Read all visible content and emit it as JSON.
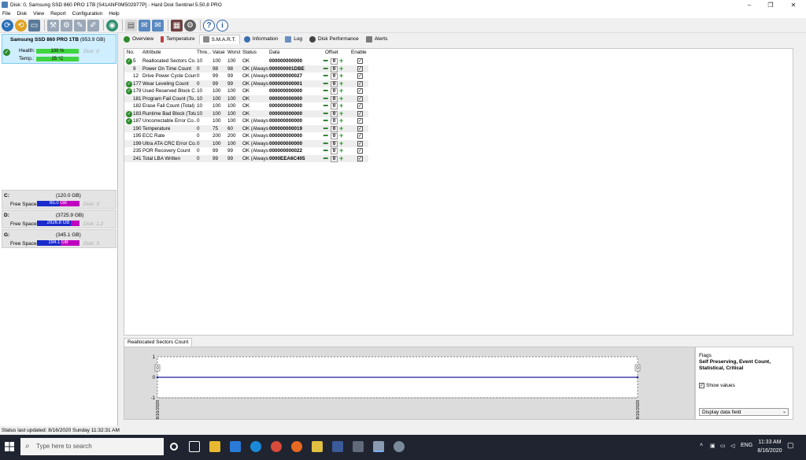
{
  "window": {
    "title": "Disk: 0, Samsung SSD 860 PRO 1TB [S41ANF0M502977P] - Hard Disk Sentinel 5.50.8 PRO",
    "minimize": "–",
    "maximize": "❐",
    "close": "✕"
  },
  "menu": [
    "File",
    "Disk",
    "View",
    "Report",
    "Configuration",
    "Help"
  ],
  "toolbar_icons": [
    "refresh-icon",
    "update-icon",
    "disk-icon",
    "wrench-icon",
    "tools-icon",
    "test-icon",
    "surface-icon",
    "globe-icon",
    "report-icon",
    "send-icon",
    "send2-icon",
    "screen-icon",
    "settings-icon",
    "help-icon",
    "info-icon"
  ],
  "disk": {
    "name": "Samsung SSD 860 PRO 1TB",
    "size": "(953.9 GB)",
    "health_label": "Health:",
    "health_value": "100 %",
    "health_pct": 100,
    "temp_label": "Temp.:",
    "temp_value": "25 °C",
    "disk_no": "Disk: 0"
  },
  "volumes": [
    {
      "letter": "C:",
      "size": "(120.0 GB)",
      "free_label": "Free Space",
      "free": "65.0 GB",
      "free_pct": 54,
      "disk": "Disk: 3"
    },
    {
      "letter": "D:",
      "size": "(3725.9 GB)",
      "free_label": "Free Space",
      "free": "2926.8 GB",
      "free_pct": 79,
      "disk": "Disk: 1,2"
    },
    {
      "letter": "G:",
      "size": "(345.1 GB)",
      "free_label": "Free Space",
      "free": "194.1 GB",
      "free_pct": 56,
      "disk": "Disk: 3"
    }
  ],
  "tabs": [
    {
      "label": "Overview",
      "icon": "ok-icon",
      "color": "#2e8b2e",
      "active": false
    },
    {
      "label": "Temperature",
      "icon": "thermometer-icon",
      "color": "#c04040",
      "active": false
    },
    {
      "label": "S.M.A.R.T.",
      "icon": "smart-icon",
      "color": "#888888",
      "active": true
    },
    {
      "label": "Information",
      "icon": "info-icon",
      "color": "#3a6fb0",
      "active": false
    },
    {
      "label": "Log",
      "icon": "log-icon",
      "color": "#6a8fc0",
      "active": false
    },
    {
      "label": "Disk Performance",
      "icon": "performance-icon",
      "color": "#444444",
      "active": false
    },
    {
      "label": "Alerts",
      "icon": "alerts-icon",
      "color": "#7a7a7a",
      "active": false
    }
  ],
  "smart": {
    "headers": [
      "No.",
      "Attribute",
      "Thre...",
      "Value",
      "Worst",
      "Status",
      "Data",
      "Offset",
      "Enable"
    ],
    "rows": [
      {
        "ok": true,
        "no": "5",
        "attr": "Reallocated Sectors Co...",
        "thr": "10",
        "val": "100",
        "worst": "100",
        "status": "OK",
        "data": "000000000000",
        "offset": "0"
      },
      {
        "ok": false,
        "no": "9",
        "attr": "Power On Time Count",
        "thr": "0",
        "val": "98",
        "worst": "98",
        "status": "OK (Always...",
        "data": "000000001DBE",
        "offset": "0"
      },
      {
        "ok": false,
        "no": "12",
        "attr": "Drive Power Cycle Count",
        "thr": "0",
        "val": "99",
        "worst": "99",
        "status": "OK (Always...",
        "data": "000000000027",
        "offset": "0"
      },
      {
        "ok": true,
        "no": "177",
        "attr": "Wear Leveling Count",
        "thr": "0",
        "val": "99",
        "worst": "99",
        "status": "OK (Always...",
        "data": "000000000001",
        "offset": "0"
      },
      {
        "ok": true,
        "no": "179",
        "attr": "Used Reserved Block C...",
        "thr": "10",
        "val": "100",
        "worst": "100",
        "status": "OK",
        "data": "000000000000",
        "offset": "0"
      },
      {
        "ok": false,
        "no": "181",
        "attr": "Program Fail Count (To...",
        "thr": "10",
        "val": "100",
        "worst": "100",
        "status": "OK",
        "data": "000000000000",
        "offset": "0"
      },
      {
        "ok": false,
        "no": "182",
        "attr": "Erase Fail Count (Total)",
        "thr": "10",
        "val": "100",
        "worst": "100",
        "status": "OK",
        "data": "000000000000",
        "offset": "0"
      },
      {
        "ok": true,
        "no": "183",
        "attr": "Runtime Bad Block (Total)",
        "thr": "10",
        "val": "100",
        "worst": "100",
        "status": "OK",
        "data": "000000000000",
        "offset": "0"
      },
      {
        "ok": true,
        "no": "187",
        "attr": "Uncorrectable Error Co...",
        "thr": "0",
        "val": "100",
        "worst": "100",
        "status": "OK (Always...",
        "data": "000000000000",
        "offset": "0"
      },
      {
        "ok": false,
        "no": "190",
        "attr": "Temperature",
        "thr": "0",
        "val": "75",
        "worst": "60",
        "status": "OK (Always...",
        "data": "000000000019",
        "offset": "0"
      },
      {
        "ok": false,
        "no": "195",
        "attr": "ECC Rate",
        "thr": "0",
        "val": "200",
        "worst": "200",
        "status": "OK (Always...",
        "data": "000000000000",
        "offset": "0"
      },
      {
        "ok": false,
        "no": "199",
        "attr": "Ultra ATA CRC Error Co...",
        "thr": "0",
        "val": "100",
        "worst": "100",
        "status": "OK (Always...",
        "data": "000000000000",
        "offset": "0"
      },
      {
        "ok": false,
        "no": "235",
        "attr": "POR Recovery Count",
        "thr": "0",
        "val": "99",
        "worst": "99",
        "status": "OK (Always...",
        "data": "000000000022",
        "offset": "0"
      },
      {
        "ok": false,
        "no": "241",
        "attr": "Total LBA Written",
        "thr": "0",
        "val": "99",
        "worst": "99",
        "status": "OK (Always...",
        "data": "0000EEA6C405",
        "offset": "0"
      }
    ]
  },
  "chart_tab": "Reallocated Sectors Count",
  "chart_data": {
    "type": "line",
    "title": "",
    "xlabel": "",
    "ylabel": "",
    "x": [
      "8/16/2020",
      "8/16/2020"
    ],
    "series": [
      {
        "values": [
          0,
          0
        ]
      }
    ],
    "y_ticks": [
      "1",
      "0",
      "-1"
    ],
    "ylim": [
      -1,
      1
    ],
    "point_labels": [
      "0",
      "0"
    ],
    "line_color": "#1a1aa0",
    "grid": true
  },
  "flags": {
    "label": "Flags",
    "value": "Self Preserving, Event Count, Statistical, Critical",
    "show_values_label": "Show values",
    "show_values_checked": true,
    "dropdown": "Display data field"
  },
  "status": "Status last updated: 8/16/2020 Sunday 11:32:31 AM",
  "taskbar": {
    "search_placeholder": "Type here to search",
    "time": "11:33 AM",
    "date": "8/16/2020",
    "lang": "ENG"
  }
}
